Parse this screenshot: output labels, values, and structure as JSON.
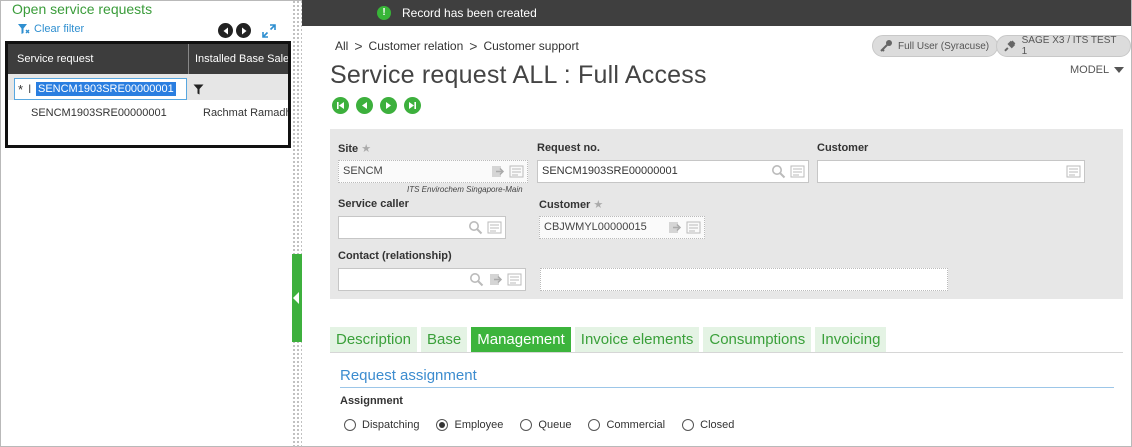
{
  "left_panel": {
    "title": "Open service requests",
    "clear_filter": "Clear filter",
    "columns": [
      "Service request",
      "Installed Base Sales"
    ],
    "filter_value": "SENCM1903SRE00000001",
    "rows": [
      {
        "service_request": "SENCM1903SRE00000001",
        "installed_base_sales": "Rachmat Ramadhan"
      }
    ]
  },
  "notification": {
    "icon": "exclamation-icon",
    "message": "Record has been created"
  },
  "breadcrumb": [
    "All",
    "Customer relation",
    "Customer support"
  ],
  "user_pill": "Full User (Syracuse)",
  "endpoint_pill": "SAGE X3 / ITS TEST 1",
  "page_title": "Service request ALL : Full Access",
  "model_label": "MODEL",
  "form": {
    "site_label": "Site",
    "site_value": "SENCM",
    "site_caption": "ITS Envirochem Singapore-Main",
    "request_no_label": "Request no.",
    "request_no_value": "SENCM1903SRE00000001",
    "customer_label": "Customer",
    "customer_value": "",
    "service_caller_label": "Service caller",
    "service_caller_value": "",
    "customer2_label": "Customer",
    "customer2_value": "CBJWMYL00000015",
    "contact_label": "Contact (relationship)",
    "contact_value": "",
    "contact_name_value": ""
  },
  "tabs": [
    "Description",
    "Base",
    "Management",
    "Invoice elements",
    "Consumptions",
    "Invoicing"
  ],
  "active_tab": "Management",
  "section_title": "Request assignment",
  "assignment_label": "Assignment",
  "assignment_options": [
    "Dispatching",
    "Employee",
    "Queue",
    "Commercial",
    "Closed"
  ],
  "assignment_selected": "Employee",
  "colors": {
    "accent_green": "#3cb43c",
    "link_blue": "#2f8fd0",
    "header_dark": "#3f3f3f"
  }
}
